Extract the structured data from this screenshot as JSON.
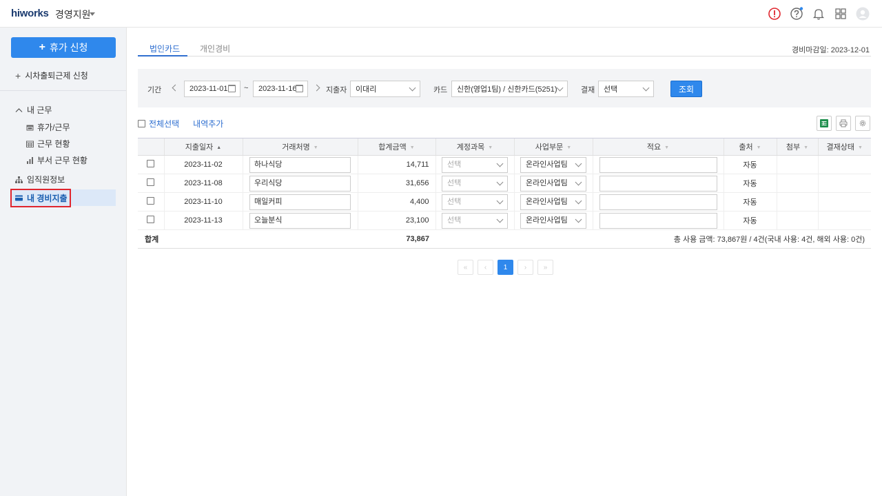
{
  "header": {
    "logo": "hiworks",
    "app_name": "경영지원",
    "icons": [
      "alert-icon",
      "help-icon",
      "bell-icon",
      "apps-grid-icon",
      "user-avatar"
    ]
  },
  "sidebar": {
    "leave_button": "휴가 신청",
    "flex_work": "시차출퇴근제 신청",
    "my_work_section": "내 근무",
    "sub_items": [
      "휴가/근무",
      "근무 현황",
      "부서 근무 현황"
    ],
    "employee_info": "임직원정보",
    "my_expense": "내 경비지출"
  },
  "tabs": [
    "법인카드",
    "개인경비"
  ],
  "deadline": "경비마감일: 2023-12-01",
  "filter": {
    "period_label": "기간",
    "date_from": "2023-11-01",
    "tilde": "~",
    "date_to": "2023-11-16",
    "spender_label": "지출자",
    "spender_value": "이대리",
    "card_label": "카드",
    "card_value": "신한(영업1팀) / 신한카드(5251)",
    "approval_label": "결재",
    "approval_value": "선택",
    "search_button": "조회"
  },
  "actions": {
    "select_all": "전체선택",
    "add_item": "내역추가"
  },
  "table": {
    "columns": [
      "지출일자",
      "거래처명",
      "합계금액",
      "계정과목",
      "사업부문",
      "적요",
      "출처",
      "첨부",
      "결재상태"
    ],
    "rows": [
      {
        "date": "2023-11-02",
        "vendor": "하나식당",
        "amount": "14,711",
        "account": "선택",
        "division": "온라인사업팀",
        "source": "자동"
      },
      {
        "date": "2023-11-08",
        "vendor": "우리식당",
        "amount": "31,656",
        "account": "선택",
        "division": "온라인사업팀",
        "source": "자동"
      },
      {
        "date": "2023-11-10",
        "vendor": "매일커피",
        "amount": "4,400",
        "account": "선택",
        "division": "온라인사업팀",
        "source": "자동"
      },
      {
        "date": "2023-11-13",
        "vendor": "오늘분식",
        "amount": "23,100",
        "account": "선택",
        "division": "온라인사업팀",
        "source": "자동"
      }
    ],
    "total_label": "합계",
    "total_amount": "73,867",
    "summary": "총 사용 금액: 73,867원 / 4건(국내 사용: 4건, 해외 사용: 0건)"
  },
  "pagination": {
    "current": "1",
    "first": "«",
    "prev": "‹",
    "next": "›",
    "last": "»"
  },
  "colors": {
    "primary": "#2f88ec",
    "accent_text": "#2f6fd0",
    "sidebar_bg": "#f1f3f6",
    "active_bg": "#dce8f8",
    "highlight_border": "#e0252d"
  }
}
